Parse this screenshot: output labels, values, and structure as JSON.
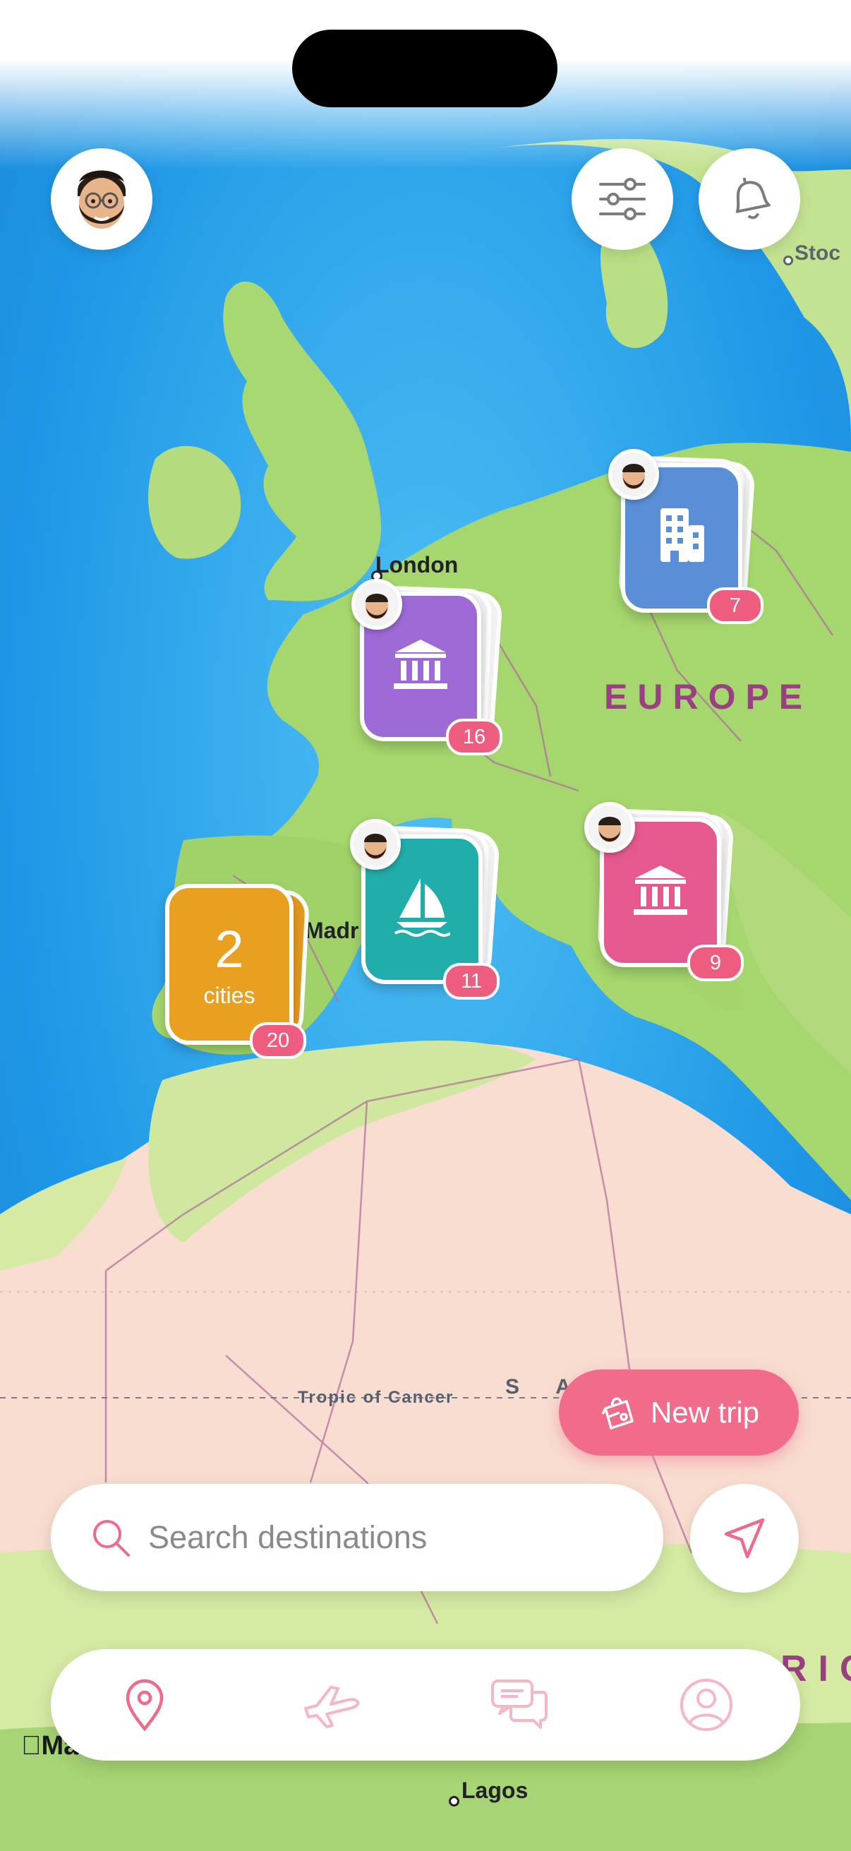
{
  "map": {
    "labels": {
      "london": "London",
      "europe": "EUROPE",
      "madrid": "Madr",
      "tropic": "Tropic of Cancer",
      "sahara": "S A",
      "lagos": "Lagos",
      "stockholm": "Stoc",
      "africa": "RIC",
      "attribution": "Ma"
    }
  },
  "pins": [
    {
      "id": "london",
      "icon": "museum-icon",
      "color": "#9d6ad6",
      "count": "16"
    },
    {
      "id": "berlin",
      "icon": "building-icon",
      "color": "#5a8fd8",
      "count": "7"
    },
    {
      "id": "barcelona",
      "icon": "sailboat-icon",
      "color": "#21ada9",
      "count": "11"
    },
    {
      "id": "rome",
      "icon": "museum-icon",
      "color": "#e6598f",
      "count": "9"
    },
    {
      "id": "portugal",
      "icon": "",
      "color": "#e9a021",
      "count": "20",
      "number": "2",
      "caption": "cities"
    }
  ],
  "actions": {
    "new_trip_label": "New trip"
  },
  "search": {
    "placeholder": "Search destinations"
  },
  "tabs": [
    {
      "id": "map",
      "icon": "map-pin-icon",
      "active": true
    },
    {
      "id": "flights",
      "icon": "airplane-icon",
      "active": false
    },
    {
      "id": "messages",
      "icon": "chat-bubbles-icon",
      "active": false
    },
    {
      "id": "profile",
      "icon": "person-icon",
      "active": false
    }
  ],
  "colors": {
    "accent": "#f06c8a",
    "sea": "#3aa8e6",
    "land": "#bfe28a",
    "desert": "#f8ddd0"
  }
}
